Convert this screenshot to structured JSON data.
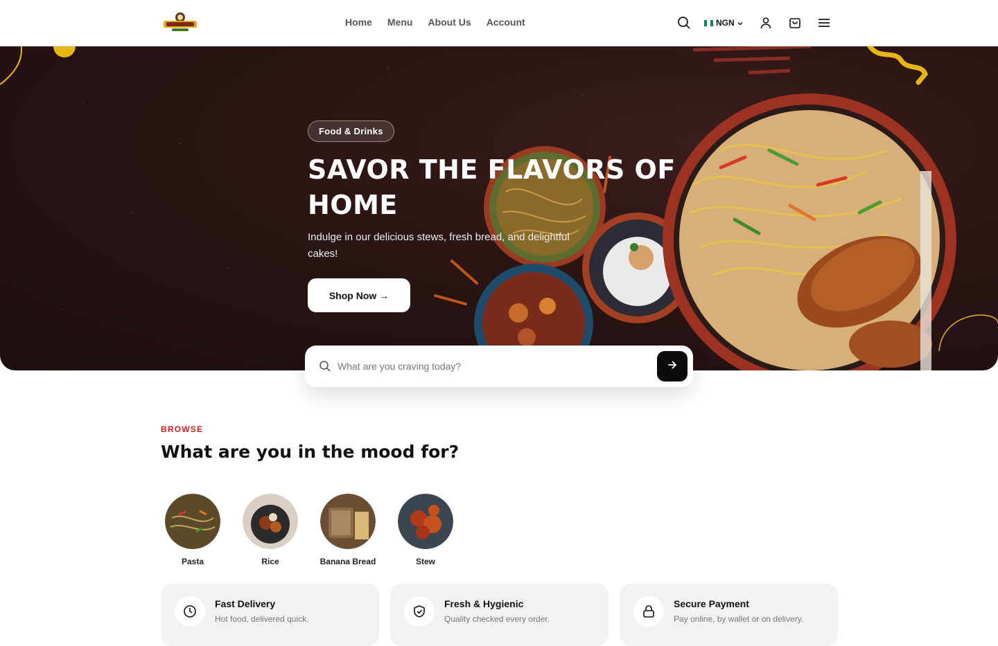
{
  "header": {
    "logo_alt": "Mamakazi",
    "nav": [
      "Home",
      "Menu",
      "About Us",
      "Account"
    ],
    "currency": "NGN",
    "icons": [
      "search-icon",
      "user-icon",
      "cart-icon",
      "menu-icon"
    ]
  },
  "hero": {
    "badge": "Food & Drinks",
    "title": "SAVOR THE FLAVORS OF HOME",
    "subtitle": "Indulge in our delicious stews, fresh bread, and delightful cakes!",
    "cta": "Shop Now →"
  },
  "search": {
    "placeholder": "What are you craving today?"
  },
  "browse": {
    "eyebrow": "BROWSE",
    "title": "What are you in the mood for?",
    "categories": [
      {
        "label": "Pasta"
      },
      {
        "label": "Rice"
      },
      {
        "label": "Banana Bread"
      },
      {
        "label": "Stew"
      }
    ]
  },
  "features": [
    {
      "title": "Fast Delivery",
      "desc": "Hot food, delivered quick.",
      "icon": "clock-icon"
    },
    {
      "title": "Fresh & Hygienic",
      "desc": "Quality checked every order.",
      "icon": "shield-icon"
    },
    {
      "title": "Secure Payment",
      "desc": "Pay online, by wallet or on delivery.",
      "icon": "lock-icon"
    }
  ],
  "colors": {
    "accent": "#c8201f",
    "hero_bg": "#2a1414",
    "decor_yellow": "#e7b514",
    "button_dark": "#0b0b0b",
    "card_bg": "#f2f2f2"
  }
}
